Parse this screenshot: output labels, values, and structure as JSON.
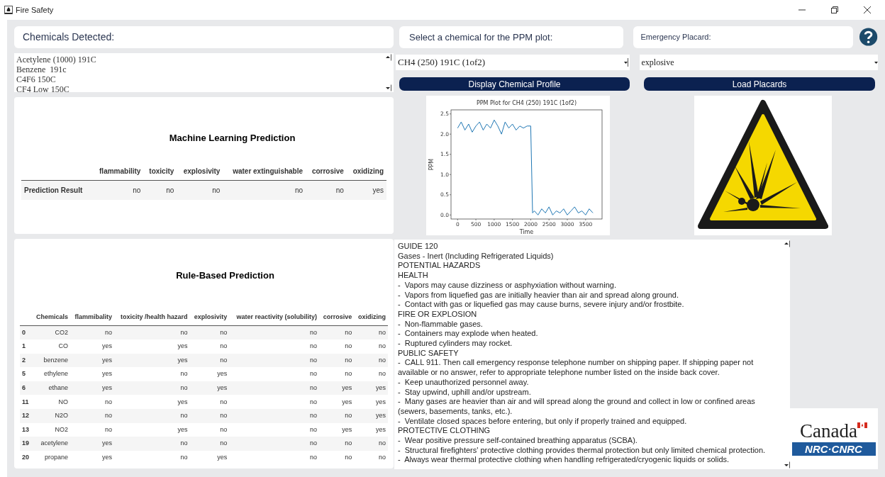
{
  "window": {
    "title": "Fire Safety"
  },
  "chemicals_detected": {
    "label": "Chemicals Detected:",
    "items": [
      "Acetylene (1000) 191C",
      "Benzene  191c",
      "C4F6 150C",
      "CF4 Low 150C"
    ]
  },
  "ml_prediction": {
    "title": "Machine Learning Prediction",
    "columns": [
      "flammability",
      "toxicity",
      "explosivity",
      "water extinguishable",
      "corrosive",
      "oxidizing"
    ],
    "rows": [
      {
        "label": "Prediction Result",
        "cells": [
          "no",
          "no",
          "no",
          "no",
          "no",
          "yes"
        ]
      }
    ]
  },
  "rule_prediction": {
    "title": "Rule-Based Prediction",
    "columns": [
      "Chemicals",
      "flammibality",
      "toxicity /health hazard",
      "explosivity",
      "water reactivity (solubility)",
      "corrosive",
      "oxidizing"
    ],
    "rows": [
      {
        "index": "0",
        "cells": [
          "CO2",
          "no",
          "no",
          "no",
          "no",
          "no",
          "no"
        ]
      },
      {
        "index": "1",
        "cells": [
          "CO",
          "yes",
          "yes",
          "no",
          "no",
          "no",
          "no"
        ]
      },
      {
        "index": "2",
        "cells": [
          "benzene",
          "yes",
          "yes",
          "no",
          "no",
          "no",
          "no"
        ]
      },
      {
        "index": "5",
        "cells": [
          "ethylene",
          "yes",
          "no",
          "yes",
          "no",
          "no",
          "no"
        ]
      },
      {
        "index": "6",
        "cells": [
          "ethane",
          "yes",
          "no",
          "yes",
          "no",
          "yes",
          "yes"
        ]
      },
      {
        "index": "11",
        "cells": [
          "NO",
          "no",
          "yes",
          "no",
          "no",
          "yes",
          "yes"
        ]
      },
      {
        "index": "12",
        "cells": [
          "N2O",
          "no",
          "no",
          "no",
          "no",
          "no",
          "yes"
        ]
      },
      {
        "index": "13",
        "cells": [
          "NO2",
          "no",
          "yes",
          "no",
          "no",
          "yes",
          "yes"
        ]
      },
      {
        "index": "19",
        "cells": [
          "acetylene",
          "yes",
          "no",
          "no",
          "no",
          "no",
          "no"
        ]
      },
      {
        "index": "20",
        "cells": [
          "propane",
          "yes",
          "no",
          "yes",
          "no",
          "no",
          "no"
        ]
      }
    ]
  },
  "ppm": {
    "label": "Select a chemical for the PPM plot:",
    "selected_chemical": "CH4 (250) 191C (1of2)",
    "button": "Display Chemical Profile",
    "chart_data": {
      "type": "line",
      "title": "PPM Plot for CH4 (250) 191C (1of2)",
      "xlabel": "Time",
      "ylabel": "PPM",
      "x": [
        0,
        100,
        200,
        300,
        400,
        500,
        600,
        700,
        800,
        900,
        1000,
        1100,
        1200,
        1300,
        1400,
        1500,
        1600,
        1700,
        1800,
        1900,
        2000,
        2050,
        2100,
        2200,
        2300,
        2400,
        2500,
        2600,
        2700,
        2800,
        2900,
        3000,
        3100,
        3200,
        3300,
        3400,
        3500,
        3600,
        3700
      ],
      "series": [
        {
          "color": "#1f77b4",
          "values": [
            2.15,
            2.3,
            2.1,
            2.25,
            2.05,
            2.2,
            2.3,
            2.1,
            2.25,
            2.15,
            2.35,
            2.2,
            2.0,
            2.3,
            2.15,
            2.25,
            2.1,
            2.2,
            2.15,
            2.2,
            2.2,
            0.05,
            0.1,
            0.0,
            0.15,
            0.05,
            0.2,
            0.0,
            0.1,
            0.05,
            0.15,
            0.0,
            0.1,
            0.2,
            0.05,
            0.1,
            0.0,
            0.15,
            0.05
          ]
        }
      ],
      "xlim": [
        -180,
        3950
      ],
      "ylim": [
        -0.1,
        2.6
      ],
      "xticks": [
        0,
        500,
        1000,
        1500,
        2000,
        2500,
        3000,
        3500
      ],
      "yticks": [
        {
          "value": 0,
          "label": "0.0"
        },
        0.5,
        {
          "value": 1,
          "label": "1.0"
        },
        1.5,
        {
          "value": 2,
          "label": "2.0"
        },
        2.5
      ]
    }
  },
  "placard": {
    "label": "Emergency Placard:",
    "selected": "explosive",
    "button": "Load Placards"
  },
  "guide": {
    "lines": [
      "GUIDE 120",
      "Gases - Inert (Including Refrigerated Liquids)",
      "POTENTIAL HAZARDS",
      "HEALTH",
      "-  Vapors may cause dizziness or asphyxiation without warning.",
      "-  Vapors from liquefied gas are initially heavier than air and spread along ground.",
      "-  Contact with gas or liquefied gas may cause burns, severe injury and/or frostbite.",
      "FIRE OR EXPLOSION",
      "-  Non-flammable gases.",
      "-  Containers may explode when heated.",
      "-  Ruptured cylinders may rocket.",
      "PUBLIC SAFETY",
      "-  CALL 911. Then call emergency response telephone number on shipping paper. If shipping paper not available or no answer, refer to appropriate telephone number listed on the inside back cover.",
      "-  Keep unauthorized personnel away.",
      "-  Stay upwind, uphill and/or upstream.",
      "-  Many gases are heavier than air and will spread along the ground and collect in low or confined areas (sewers, basements, tanks, etc.).",
      "-  Ventilate closed spaces before entering, but only if properly trained and equipped.",
      "PROTECTIVE CLOTHING",
      "-  Wear positive pressure self-contained breathing apparatus (SCBA).",
      "-  Structural firefighters' protective clothing provides thermal protection but only limited chemical protection.",
      "-  Always wear thermal protective clothing when handling refrigerated/cryogenic liquids or solids."
    ]
  },
  "logo": {
    "wordmark": "Canada",
    "agency": "NRC·CNRC"
  }
}
